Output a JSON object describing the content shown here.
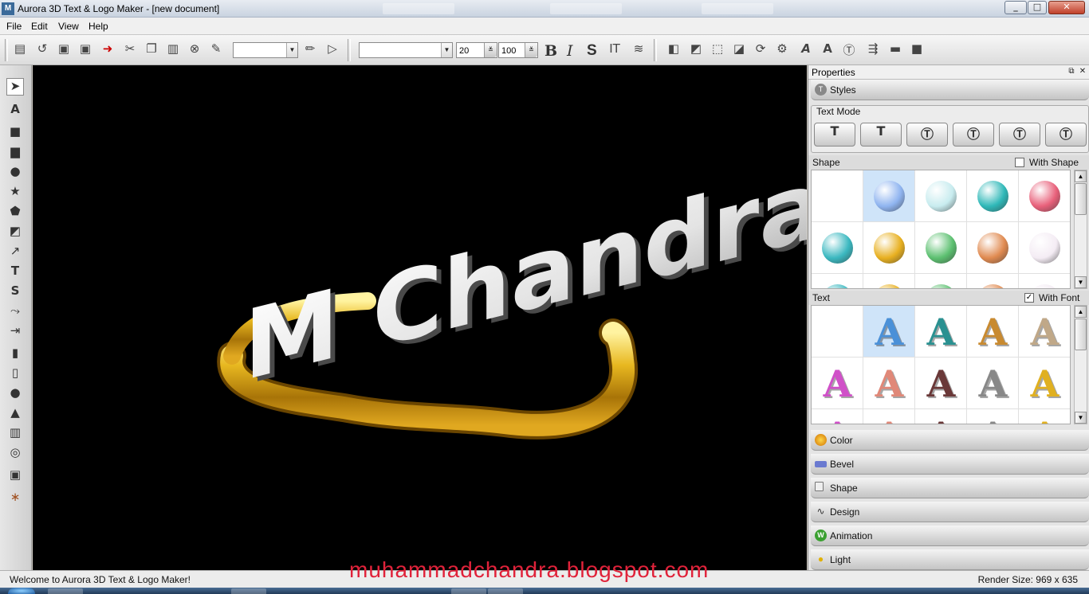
{
  "window": {
    "title": "Aurora 3D Text & Logo Maker - [new document]",
    "app_icon_text": "M",
    "controls": [
      "minimize-icon",
      "maximize-icon",
      "close-icon"
    ]
  },
  "menu": [
    "File",
    "Edit",
    "View",
    "Help"
  ],
  "toolbar": {
    "font_size_value": "20",
    "scale_value": "100",
    "bold_label": "B",
    "italic_label": "I",
    "strike_label": "S"
  },
  "canvas": {
    "text": "M Chandra",
    "background": "#000000",
    "text_color": "#e8e8e8",
    "ribbon_color": "#d4a017"
  },
  "panel": {
    "title": "Properties",
    "styles_label": "Styles",
    "text_mode_label": "Text Mode",
    "shape_label": "Shape",
    "with_shape_label": "With Shape",
    "with_shape_checked": false,
    "text_label": "Text",
    "with_font_label": "With Font",
    "with_font_checked": true,
    "shape_colors": [
      "",
      "#8fb4f0",
      "#c8ecef",
      "#2fb8b8",
      "#e8607a",
      "#3ab8c0",
      "#e8b020",
      "#5cc070",
      "#e08a50",
      "#f4ecf4"
    ],
    "text_colors": [
      "",
      "#4a90d8",
      "#2a9090",
      "#c88a30",
      "#c0a888",
      "#d050c8",
      "#e08878",
      "#6a3838",
      "#888888",
      "#e0b020"
    ],
    "sections": [
      "Color",
      "Bevel",
      "Shape",
      "Design",
      "Animation",
      "Light"
    ]
  },
  "status": {
    "message": "Welcome to Aurora 3D Text & Logo Maker!",
    "render_size": "Render Size: 969 x 635"
  },
  "watermark": "muhammadchandra.blogspot.com"
}
